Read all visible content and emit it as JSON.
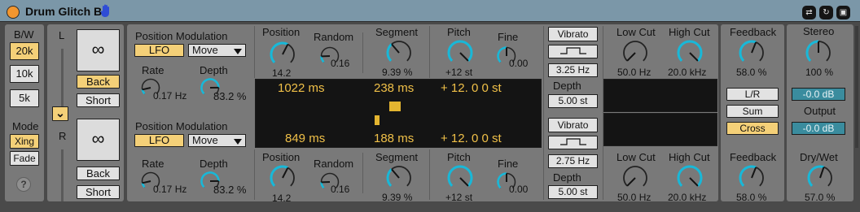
{
  "device": {
    "title": "Drum Glitch B"
  },
  "title_icons": [
    "hand-icon",
    "hot-swap-icon",
    "refresh-icon",
    "save-icon"
  ],
  "colors": {
    "accent_amber": "#f4d078",
    "teal_field": "#3a8c9e",
    "display_text": "#f0c048",
    "knob_arc": "#18b8d8",
    "title_bar": "#7b97a8"
  },
  "left": {
    "bw_label": "B/W",
    "bw_options": [
      "20k",
      "10k",
      "5k"
    ],
    "bw_selected": "20k",
    "mode_label": "Mode",
    "mode_options": [
      "Xing",
      "Fade"
    ],
    "mode_selected": "Xing",
    "help": "?",
    "l_label": "L",
    "r_label": "R",
    "link": "∞",
    "top": {
      "back": "Back",
      "short": "Short",
      "back_on": true
    },
    "bottom": {
      "back": "Back",
      "short": "Short",
      "back_on": false
    },
    "collapse": "⌄"
  },
  "top": {
    "pos_mod": "Position Modulation",
    "lfo": "LFO",
    "move": "Move",
    "rate_label": "Rate",
    "rate": "0.17 Hz",
    "rate_frac": 0.12,
    "depth_label": "Depth",
    "depth": "83.2 %",
    "depth_frac": 0.83,
    "position_label": "Position",
    "position": "14.2",
    "position_frac": 0.6,
    "random_label": "Random",
    "random": "0.16",
    "random_frac": 0.16,
    "segment_label": "Segment",
    "segment": "9.39 %",
    "segment_frac": 0.35,
    "pitch_label": "Pitch",
    "pitch": "+12 st",
    "pitch_frac": 1.0,
    "fine_label": "Fine",
    "fine": "0.00",
    "fine_frac": 0.5,
    "vibrato": "Vibrato",
    "vib_rate": "3.25 Hz",
    "vib_depth_label": "Depth",
    "vib_depth": "5.00 st",
    "lowcut_label": "Low Cut",
    "lowcut": "50.0 Hz",
    "lowcut_frac": 0.0,
    "highcut_label": "High Cut",
    "highcut": "20.0 kHz",
    "highcut_frac": 1.0,
    "feedback_label": "Feedback",
    "feedback": "58.0 %",
    "feedback_frac": 0.58
  },
  "bottom": {
    "pos_mod": "Position Modulation",
    "lfo": "LFO",
    "move": "Move",
    "rate_label": "Rate",
    "rate": "0.17 Hz",
    "rate_frac": 0.12,
    "depth_label": "Depth",
    "depth": "83.2 %",
    "depth_frac": 0.83,
    "position_label": "Position",
    "position": "14.2",
    "position_frac": 0.6,
    "random_label": "Random",
    "random": "0.16",
    "random_frac": 0.16,
    "segment_label": "Segment",
    "segment": "9.39 %",
    "segment_frac": 0.35,
    "pitch_label": "Pitch",
    "pitch": "+12 st",
    "pitch_frac": 1.0,
    "fine_label": "Fine",
    "fine": "0.00",
    "fine_frac": 0.5,
    "vibrato": "Vibrato",
    "vib_rate": "2.75 Hz",
    "vib_depth_label": "Depth",
    "vib_depth": "5.00 st",
    "lowcut_label": "Low Cut",
    "lowcut": "50.0 Hz",
    "lowcut_frac": 0.0,
    "highcut_label": "High Cut",
    "highcut": "20.0 kHz",
    "highcut_frac": 1.0,
    "feedback_label": "Feedback",
    "feedback": "58.0 %",
    "feedback_frac": 0.58
  },
  "display": {
    "top_len": "1022 ms",
    "top_seg": "238 ms",
    "top_pitch": "+ 12. 0 0 st",
    "bot_len": "849 ms",
    "bot_seg": "188 ms",
    "bot_pitch": "+ 12. 0 0 st"
  },
  "routing": {
    "lr": "L/R",
    "sum": "Sum",
    "cross": "Cross",
    "selected": "Cross"
  },
  "right": {
    "stereo_label": "Stereo",
    "stereo": "100 %",
    "stereo_frac": 0.5,
    "db1": "-0.0 dB",
    "output_label": "Output",
    "db2": "-0.0 dB",
    "drywet_label": "Dry/Wet",
    "drywet": "57.0 %",
    "drywet_frac": 0.57
  }
}
